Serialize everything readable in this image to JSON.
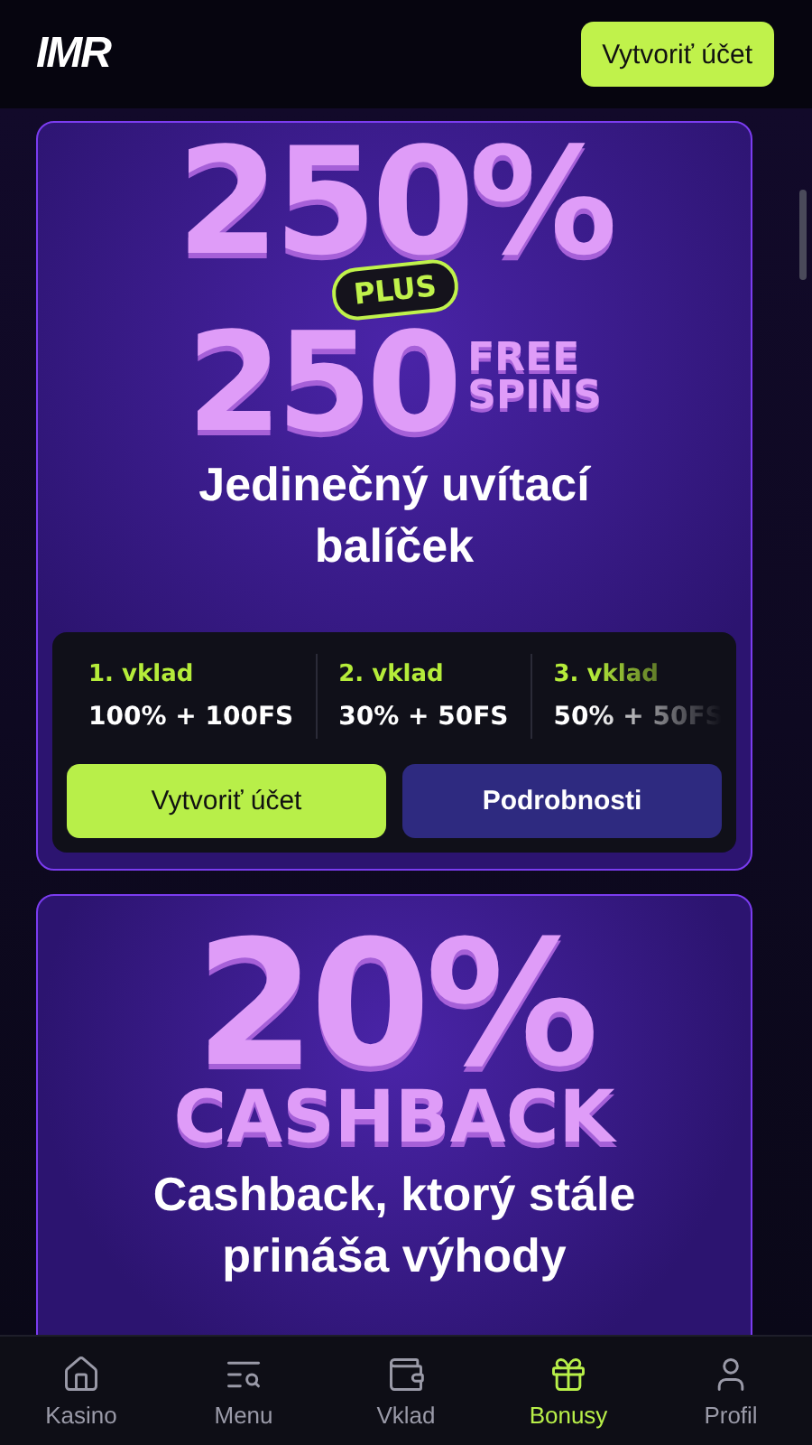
{
  "header": {
    "logo": "IMR",
    "button": "Vytvoriť účet"
  },
  "promos": [
    {
      "kind": "spins",
      "big": "250%",
      "badge": "PLUS",
      "second": "250",
      "free": "FREE",
      "spins": "SPINS",
      "subtitle": "Jedinečný uvítací balíček",
      "deposits": [
        {
          "label": "1. vklad",
          "value": "100% + 100FS"
        },
        {
          "label": "2. vklad",
          "value": "30% + 50FS"
        },
        {
          "label": "3. vklad",
          "value": "50% + 50FS"
        }
      ],
      "primary": "Vytvoriť účet",
      "secondary": "Podrobnosti"
    },
    {
      "kind": "cashback",
      "big": "20%",
      "second": "CASHBACK",
      "subtitle": "Cashback, ktorý stále prináša výhody"
    }
  ],
  "nav": [
    {
      "label": "Kasino",
      "selected": false
    },
    {
      "label": "Menu",
      "selected": false
    },
    {
      "label": "Vklad",
      "selected": false
    },
    {
      "label": "Bonusy",
      "selected": true
    },
    {
      "label": "Profil",
      "selected": false
    }
  ]
}
